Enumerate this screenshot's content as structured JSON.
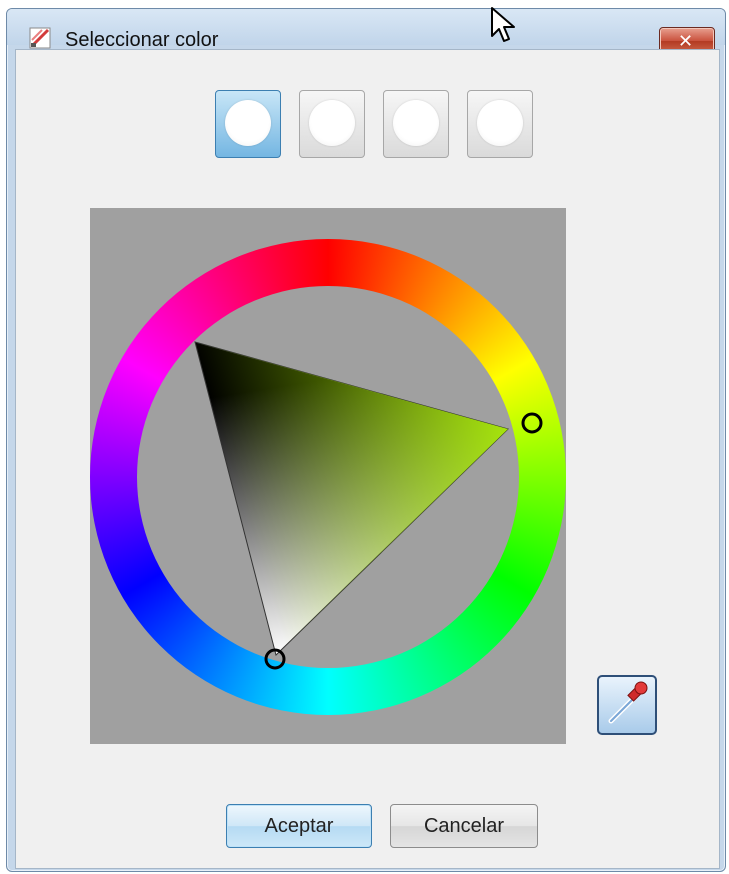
{
  "window": {
    "title": "Seleccionar color"
  },
  "swatches": {
    "count": 4,
    "selected_index": 0
  },
  "color_picker": {
    "type": "hue-ring-with-triangle",
    "hue_color": "#b6ff00",
    "selected_color": "#ffffff"
  },
  "buttons": {
    "ok_label": "Aceptar",
    "cancel_label": "Cancelar"
  },
  "icons": {
    "title_icon": "color-picker-icon",
    "close": "close-icon",
    "eyedropper": "eyedropper-icon",
    "cursor": "mouse-pointer-icon"
  },
  "colors": {
    "client_bg": "#f0f0f0",
    "wheel_bg": "#a0a0a0",
    "accent": "#3c7fb1",
    "close_red": "#c9513c"
  }
}
